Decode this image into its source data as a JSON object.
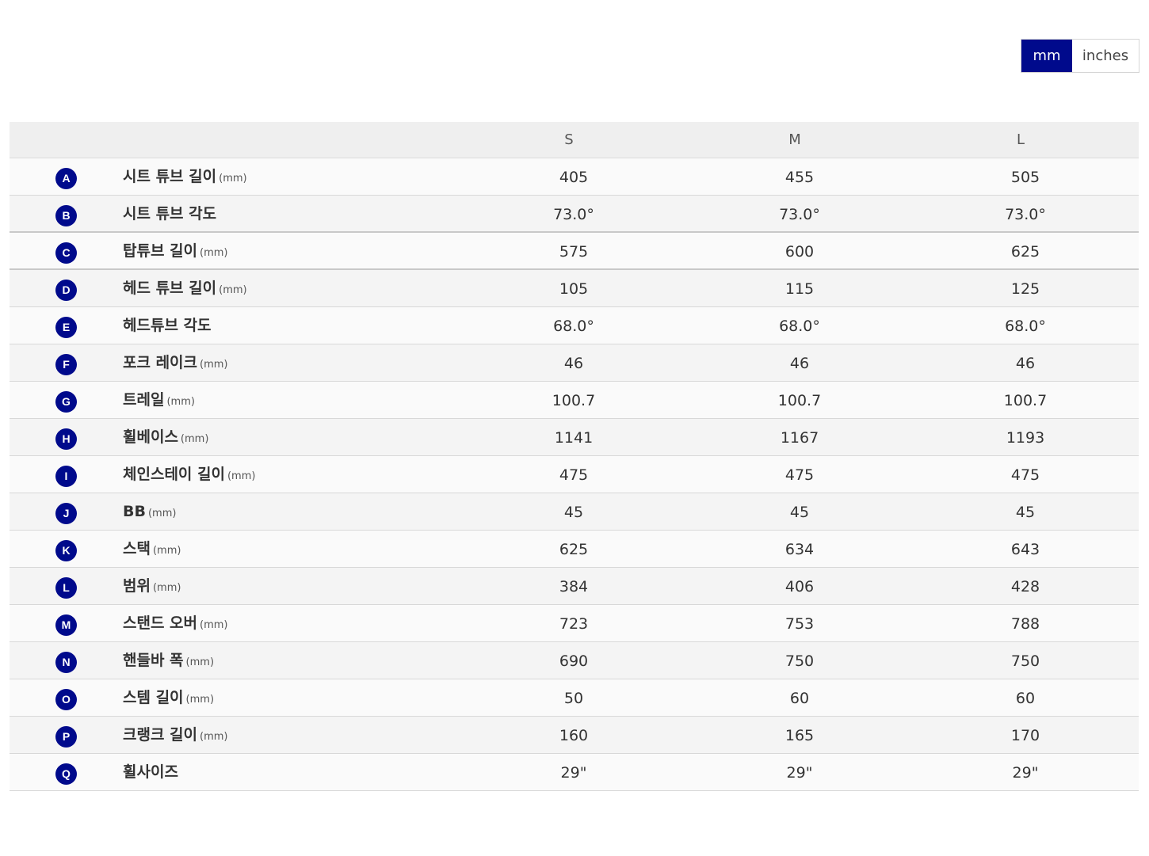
{
  "unit_toggle": {
    "mm_label": "mm",
    "inches_label": "inches",
    "selected": "mm"
  },
  "colors": {
    "accent": "#000a8c",
    "header_bg": "#efefef"
  },
  "table": {
    "columns": [
      "S",
      "M",
      "L"
    ],
    "rows": [
      {
        "key": "A",
        "label": "시트 튜브 길이",
        "unit": "(mm)",
        "values": [
          "405",
          "455",
          "505"
        ]
      },
      {
        "key": "B",
        "label": "시트 튜브 각도",
        "unit": "",
        "values": [
          "73.0°",
          "73.0°",
          "73.0°"
        ]
      },
      {
        "key": "C",
        "label": "탑튜브 길이",
        "unit": "(mm)",
        "values": [
          "575",
          "600",
          "625"
        ]
      },
      {
        "key": "D",
        "label": "헤드 튜브 길이",
        "unit": "(mm)",
        "values": [
          "105",
          "115",
          "125"
        ]
      },
      {
        "key": "E",
        "label": "헤드튜브 각도",
        "unit": "",
        "values": [
          "68.0°",
          "68.0°",
          "68.0°"
        ]
      },
      {
        "key": "F",
        "label": "포크 레이크",
        "unit": "(mm)",
        "values": [
          "46",
          "46",
          "46"
        ]
      },
      {
        "key": "G",
        "label": "트레일",
        "unit": "(mm)",
        "values": [
          "100.7",
          "100.7",
          "100.7"
        ]
      },
      {
        "key": "H",
        "label": "휠베이스",
        "unit": "(mm)",
        "values": [
          "1141",
          "1167",
          "1193"
        ]
      },
      {
        "key": "I",
        "label": "체인스테이 길이",
        "unit": "(mm)",
        "values": [
          "475",
          "475",
          "475"
        ]
      },
      {
        "key": "J",
        "label": "BB",
        "unit": "(mm)",
        "values": [
          "45",
          "45",
          "45"
        ]
      },
      {
        "key": "K",
        "label": "스택",
        "unit": "(mm)",
        "values": [
          "625",
          "634",
          "643"
        ]
      },
      {
        "key": "L",
        "label": "범위",
        "unit": "(mm)",
        "values": [
          "384",
          "406",
          "428"
        ]
      },
      {
        "key": "M",
        "label": "스탠드 오버",
        "unit": "(mm)",
        "values": [
          "723",
          "753",
          "788"
        ]
      },
      {
        "key": "N",
        "label": "핸들바 폭",
        "unit": "(mm)",
        "values": [
          "690",
          "750",
          "750"
        ]
      },
      {
        "key": "O",
        "label": "스템 길이",
        "unit": "(mm)",
        "values": [
          "50",
          "60",
          "60"
        ]
      },
      {
        "key": "P",
        "label": "크랭크 길이",
        "unit": "(mm)",
        "values": [
          "160",
          "165",
          "170"
        ]
      },
      {
        "key": "Q",
        "label": "휠사이즈",
        "unit": "",
        "values": [
          "29\"",
          "29\"",
          "29\""
        ]
      }
    ]
  }
}
